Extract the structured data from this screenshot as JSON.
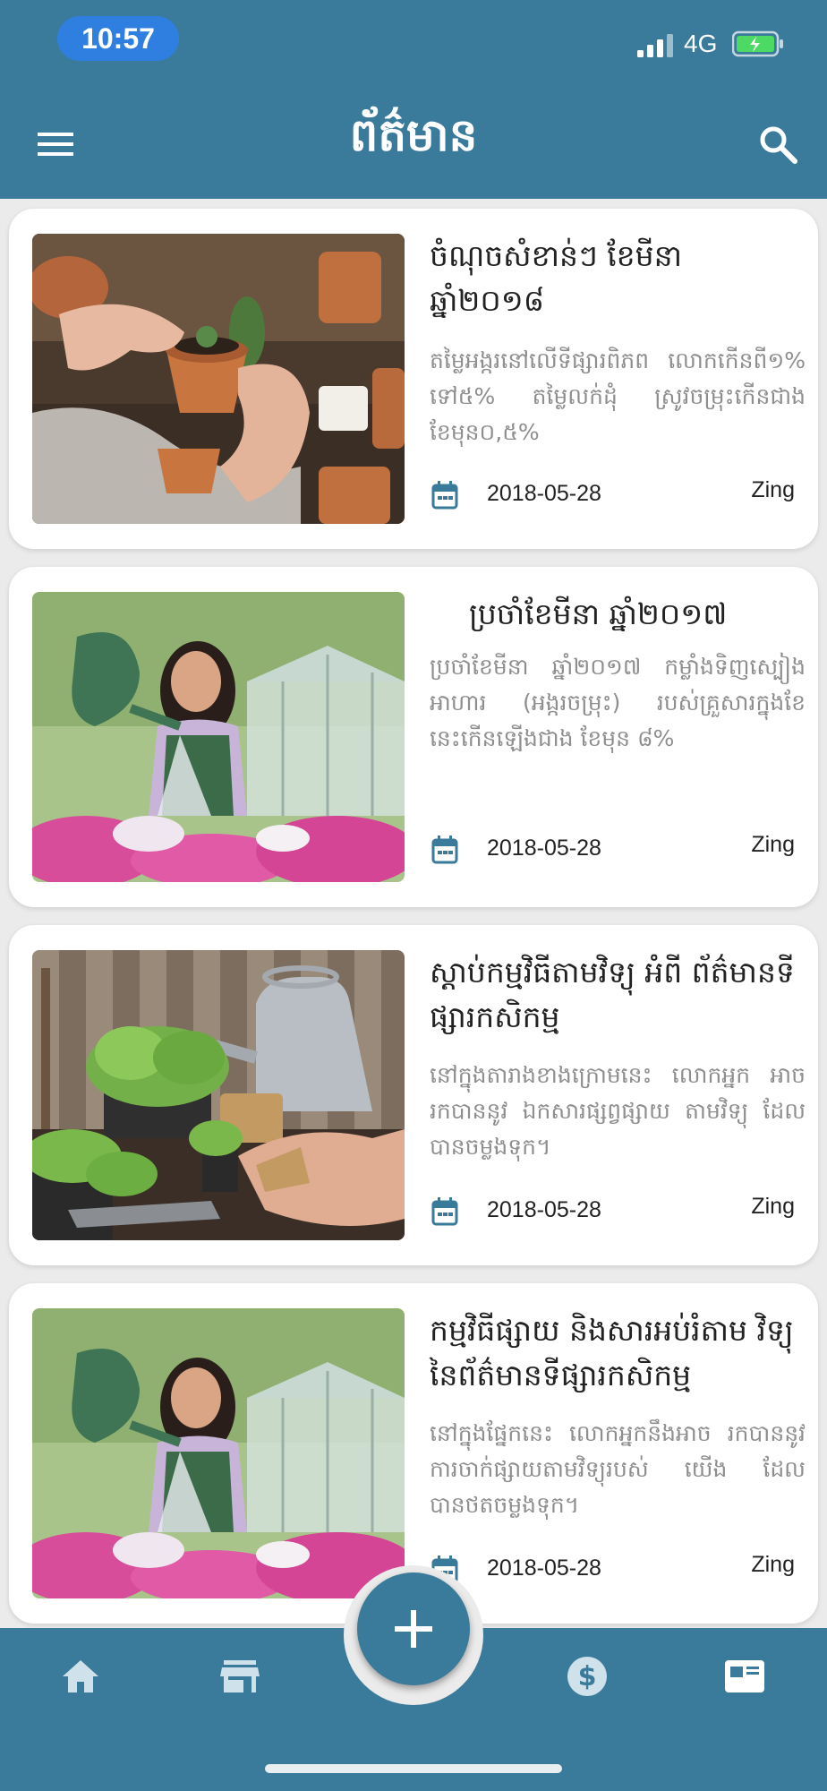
{
  "status_bar": {
    "time": "10:57",
    "network": "4G"
  },
  "header": {
    "title": "ព័ត៌មាន"
  },
  "articles": [
    {
      "title": "ចំណុចសំខាន់ៗ ខែមីនា ឆ្នាំ២០១៨",
      "description": "តម្លៃអង្ករនៅលើទីផ្សារពិភព លោកកើនពី១% ទៅ៥% តម្លៃលក់ដុំ ស្រូវចម្រុះកើនជាងខែមុន០,៥%",
      "date": "2018-05-28",
      "source": "Zing"
    },
    {
      "title": "ប្រចាំខែមីនា ឆ្នាំ២០១៧",
      "description": "ប្រចាំខែមីនា ឆ្នាំ២០១៧ កម្លាំងទិញស្បៀងអាហារ (អង្ករចម្រុះ) របស់គ្រួសារក្នុងខែនេះកើនឡើងជាង ខែមុន ៨%",
      "date": "2018-05-28",
      "source": "Zing"
    },
    {
      "title": "ស្តាប់កម្មវិធីតាមវិទ្យុ អំពី ព័ត៌មានទីផ្សារកសិកម្ម",
      "description": "នៅក្នុងតារាងខាងក្រោមនេះ លោកអ្នក អាចរកបាននូវ ឯកសារផ្សព្វផ្សាយ តាមវិទ្យុ ដែលបានចម្លងទុក។",
      "date": "2018-05-28",
      "source": "Zing"
    },
    {
      "title": "កម្មវិធីផ្សាយ និងសារអប់រំតាម វិទ្យុ នៃព័ត៌មានទីផ្សារកសិកម្ម",
      "description": "នៅក្នុងផ្នែកនេះ លោកអ្នកនឹងអាច រកបាននូវ ការចាក់ផ្សាយតាមវិទ្យុរបស់ យើង ដែលបានថតចម្លងទុក។",
      "date": "2018-05-28",
      "source": "Zing"
    }
  ],
  "icons": {
    "menu": "hamburger-menu-icon",
    "search": "search-icon",
    "calendar": "calendar-icon",
    "home": "home-icon",
    "store": "store-icon",
    "add": "plus-icon",
    "price": "dollar-icon",
    "news": "news-icon"
  },
  "colors": {
    "primary": "#3a7a9b",
    "background": "#ebebeb",
    "time_pill": "#2f7fe0",
    "battery": "#4cd964"
  }
}
